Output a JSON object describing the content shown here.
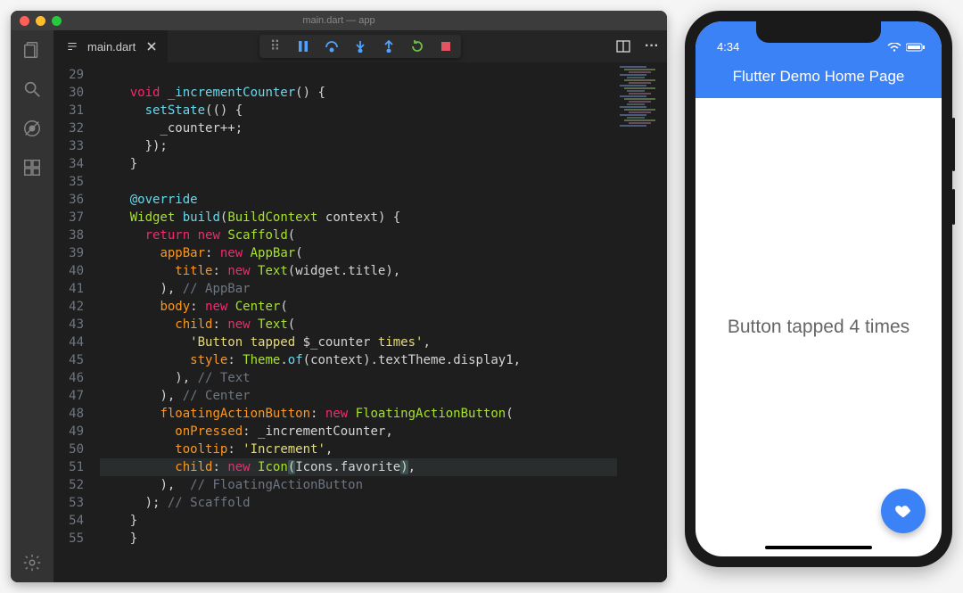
{
  "window": {
    "title": "main.dart — app"
  },
  "tab": {
    "name": "main.dart",
    "icon": "file-icon",
    "close": "×"
  },
  "toolbar": {
    "grip": "⠿",
    "splitIcon": "split-editor-icon",
    "moreIcon": "more-icon"
  },
  "activity": {
    "items": [
      "files-icon",
      "search-icon",
      "debug-icon",
      "extensions-icon"
    ],
    "bottom": "settings-gear-icon"
  },
  "gutter_start": 29,
  "gutter_end": 55,
  "code_lines": [
    [],
    [
      {
        "c": "kw",
        "t": "void"
      },
      {
        "t": " "
      },
      {
        "c": "fn",
        "t": "_incrementCounter"
      },
      {
        "c": "pun",
        "t": "() {"
      }
    ],
    [
      {
        "t": "  "
      },
      {
        "c": "fn",
        "t": "setState"
      },
      {
        "c": "pun",
        "t": "(() {"
      }
    ],
    [
      {
        "t": "    "
      },
      {
        "c": "id",
        "t": "_counter"
      },
      {
        "c": "op",
        "t": "++;"
      }
    ],
    [
      {
        "t": "  "
      },
      {
        "c": "pun",
        "t": "});"
      }
    ],
    [
      {
        "c": "pun",
        "t": "}"
      }
    ],
    [],
    [
      {
        "c": "kw2",
        "t": "@override"
      }
    ],
    [
      {
        "c": "typ",
        "t": "Widget"
      },
      {
        "t": " "
      },
      {
        "c": "fn",
        "t": "build"
      },
      {
        "c": "pun",
        "t": "("
      },
      {
        "c": "typ",
        "t": "BuildContext"
      },
      {
        "t": " "
      },
      {
        "c": "id",
        "t": "context"
      },
      {
        "c": "pun",
        "t": ") {"
      }
    ],
    [
      {
        "t": "  "
      },
      {
        "c": "kw",
        "t": "return"
      },
      {
        "t": " "
      },
      {
        "c": "kw",
        "t": "new"
      },
      {
        "t": " "
      },
      {
        "c": "typ",
        "t": "Scaffold"
      },
      {
        "c": "pun",
        "t": "("
      }
    ],
    [
      {
        "t": "    "
      },
      {
        "c": "prop",
        "t": "appBar"
      },
      {
        "c": "pun",
        "t": ": "
      },
      {
        "c": "kw",
        "t": "new"
      },
      {
        "t": " "
      },
      {
        "c": "typ",
        "t": "AppBar"
      },
      {
        "c": "pun",
        "t": "("
      }
    ],
    [
      {
        "t": "      "
      },
      {
        "c": "prop",
        "t": "title"
      },
      {
        "c": "pun",
        "t": ": "
      },
      {
        "c": "kw",
        "t": "new"
      },
      {
        "t": " "
      },
      {
        "c": "typ",
        "t": "Text"
      },
      {
        "c": "pun",
        "t": "("
      },
      {
        "c": "id",
        "t": "widget"
      },
      {
        "c": "pun",
        "t": "."
      },
      {
        "c": "id",
        "t": "title"
      },
      {
        "c": "pun",
        "t": "),"
      }
    ],
    [
      {
        "t": "    "
      },
      {
        "c": "pun",
        "t": "), "
      },
      {
        "c": "cm",
        "t": "// AppBar"
      }
    ],
    [
      {
        "t": "    "
      },
      {
        "c": "prop",
        "t": "body"
      },
      {
        "c": "pun",
        "t": ": "
      },
      {
        "c": "kw",
        "t": "new"
      },
      {
        "t": " "
      },
      {
        "c": "typ",
        "t": "Center"
      },
      {
        "c": "pun",
        "t": "("
      }
    ],
    [
      {
        "t": "      "
      },
      {
        "c": "prop",
        "t": "child"
      },
      {
        "c": "pun",
        "t": ": "
      },
      {
        "c": "kw",
        "t": "new"
      },
      {
        "t": " "
      },
      {
        "c": "typ",
        "t": "Text"
      },
      {
        "c": "pun",
        "t": "("
      }
    ],
    [
      {
        "t": "        "
      },
      {
        "c": "str",
        "t": "'Button tapped "
      },
      {
        "c": "id",
        "t": "$_counter"
      },
      {
        "c": "str",
        "t": " times'"
      },
      {
        "c": "pun",
        "t": ","
      }
    ],
    [
      {
        "t": "        "
      },
      {
        "c": "prop",
        "t": "style"
      },
      {
        "c": "pun",
        "t": ": "
      },
      {
        "c": "typ",
        "t": "Theme"
      },
      {
        "c": "pun",
        "t": "."
      },
      {
        "c": "fn",
        "t": "of"
      },
      {
        "c": "pun",
        "t": "("
      },
      {
        "c": "id",
        "t": "context"
      },
      {
        "c": "pun",
        "t": ")."
      },
      {
        "c": "id",
        "t": "textTheme"
      },
      {
        "c": "pun",
        "t": "."
      },
      {
        "c": "id",
        "t": "display1"
      },
      {
        "c": "pun",
        "t": ","
      }
    ],
    [
      {
        "t": "      "
      },
      {
        "c": "pun",
        "t": "), "
      },
      {
        "c": "cm",
        "t": "// Text"
      }
    ],
    [
      {
        "t": "    "
      },
      {
        "c": "pun",
        "t": "), "
      },
      {
        "c": "cm",
        "t": "// Center"
      }
    ],
    [
      {
        "t": "    "
      },
      {
        "c": "prop",
        "t": "floatingActionButton"
      },
      {
        "c": "pun",
        "t": ": "
      },
      {
        "c": "kw",
        "t": "new"
      },
      {
        "t": " "
      },
      {
        "c": "typ",
        "t": "FloatingActionButton"
      },
      {
        "c": "pun",
        "t": "("
      }
    ],
    [
      {
        "t": "      "
      },
      {
        "c": "prop",
        "t": "onPressed"
      },
      {
        "c": "pun",
        "t": ": "
      },
      {
        "c": "id",
        "t": "_incrementCounter"
      },
      {
        "c": "pun",
        "t": ","
      }
    ],
    [
      {
        "t": "      "
      },
      {
        "c": "prop",
        "t": "tooltip"
      },
      {
        "c": "pun",
        "t": ": "
      },
      {
        "c": "str",
        "t": "'Increment'"
      },
      {
        "c": "pun",
        "t": ","
      }
    ],
    [
      {
        "t": "      "
      },
      {
        "c": "prop",
        "t": "child"
      },
      {
        "c": "pun",
        "t": ": "
      },
      {
        "c": "kw",
        "t": "new"
      },
      {
        "t": " "
      },
      {
        "c": "typ",
        "t": "Icon"
      },
      {
        "c": "pun paren-match",
        "t": "("
      },
      {
        "c": "id",
        "t": "Icons"
      },
      {
        "c": "pun",
        "t": "."
      },
      {
        "c": "id",
        "t": "favorite"
      },
      {
        "c": "pun paren-match",
        "t": ")"
      },
      {
        "c": "pun",
        "t": ","
      }
    ],
    [
      {
        "t": "    "
      },
      {
        "c": "pun",
        "t": "),  "
      },
      {
        "c": "cm",
        "t": "// FloatingActionButton"
      }
    ],
    [
      {
        "t": "  "
      },
      {
        "c": "pun",
        "t": "); "
      },
      {
        "c": "cm",
        "t": "// Scaffold"
      }
    ],
    [
      {
        "c": "pun",
        "t": "}"
      }
    ],
    [
      {
        "c": "pun",
        "t": "}"
      }
    ],
    []
  ],
  "highlighted_line_index": 22,
  "phone": {
    "time": "4:34",
    "app_title": "Flutter Demo Home Page",
    "body_text": "Button tapped 4 times"
  }
}
